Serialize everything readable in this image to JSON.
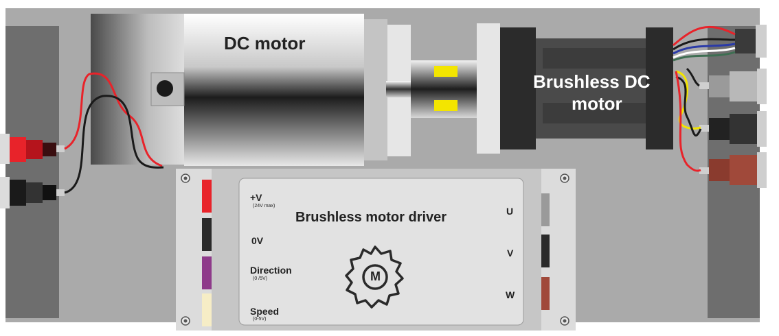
{
  "dc_motor": {
    "label": "DC motor"
  },
  "bldc_motor": {
    "label_line1": "Brushless DC",
    "label_line2": "motor"
  },
  "driver": {
    "title": "Brushless motor driver",
    "inputs": [
      {
        "label": "+V",
        "note": "(24V max)"
      },
      {
        "label": "0V",
        "note": ""
      },
      {
        "label": "Direction",
        "note": "(0 /5V)"
      },
      {
        "label": "Speed",
        "note": "(0-5V)"
      }
    ],
    "outputs": [
      {
        "label": "U"
      },
      {
        "label": "V"
      },
      {
        "label": "W"
      }
    ],
    "symbol_text": "M"
  },
  "colors": {
    "board": "#aaaaaa",
    "side_panel": "#6e6e6e",
    "red": "#e8232a",
    "black": "#1a1a1a",
    "yellow": "#f3e500",
    "purple": "#8e3a8a",
    "cream": "#f6edc6",
    "brown": "#a0493a",
    "grey_terminal": "#9a9a9a"
  },
  "icons": [
    "motor-cog-icon",
    "screw-icon",
    "banana-socket-icon"
  ]
}
